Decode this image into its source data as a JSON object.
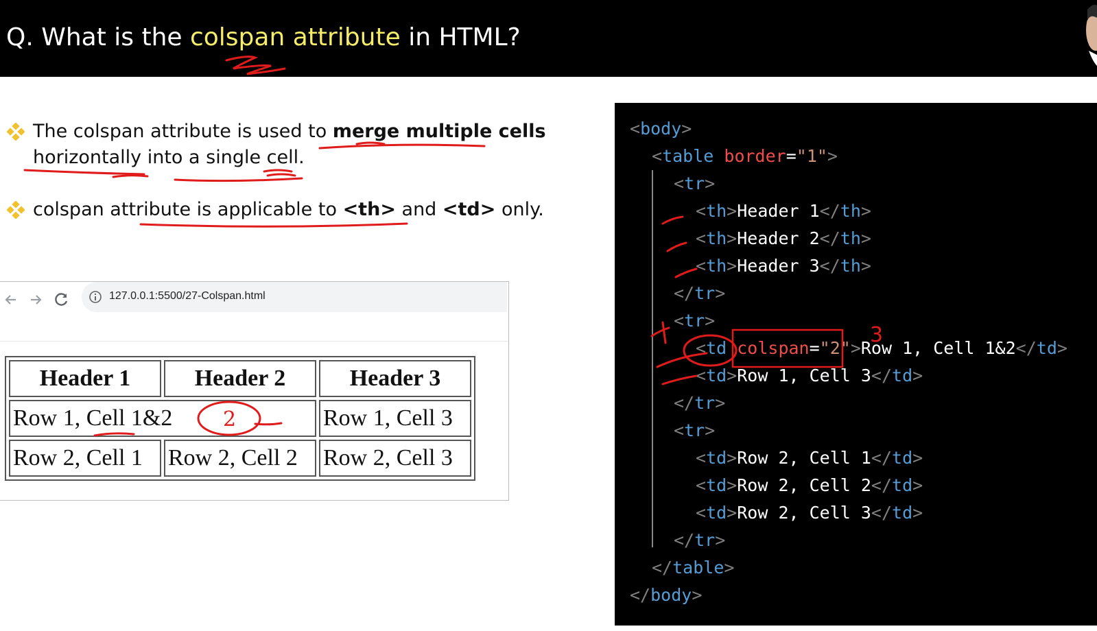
{
  "title": {
    "prefix": "Q. What is the ",
    "highlight": "colspan attribute",
    "suffix": " in HTML?"
  },
  "bullets": [
    {
      "line1_a": "The colspan attribute is used to ",
      "line1_b": "merge multiple cells",
      "line2": "horizontally into a single cell."
    },
    {
      "a": "colspan attribute is applicable to ",
      "b": "<th>",
      "c": " and ",
      "d": "<td>",
      "e": " only."
    }
  ],
  "browser": {
    "url": "127.0.0.1:5500/27-Colspan.html",
    "table": {
      "headers": [
        "Header 1",
        "Header 2",
        "Header 3"
      ],
      "row1": [
        "Row 1, Cell 1&2",
        "Row 1, Cell 3"
      ],
      "row2": [
        "Row 2, Cell 1",
        "Row 2, Cell 2",
        "Row 2, Cell 3"
      ]
    }
  },
  "annotations": {
    "title_mark": "3",
    "code_mark_a": "3",
    "code_mark_b": "1",
    "table_mark": "2"
  },
  "code": {
    "body_open": "body",
    "table_open_tag": "table",
    "table_attr": "border",
    "table_attr_val": "\"1\"",
    "tr": "tr",
    "th": "th",
    "td": "td",
    "table_close": "table",
    "body_close": "body",
    "h1": "Header 1",
    "h2": "Header 2",
    "h3": "Header 3",
    "colspan_attr": "colspan",
    "colspan_val": "\"2\"",
    "c12": "Row 1, Cell 1&2",
    "c13": "Row 1, Cell 3",
    "c21": "Row 2, Cell 1",
    "c22": "Row 2, Cell 2",
    "c23": "Row 2, Cell 3"
  },
  "colors": {
    "title_bg": "#000000",
    "title_highlight": "#f5ec6a",
    "code_bg": "#000000",
    "tag": "#569cd6",
    "attr": "#f14c4c",
    "string": "#ce9178",
    "ink": "#e01b1b",
    "bullet_mark": "#f2c12e"
  }
}
